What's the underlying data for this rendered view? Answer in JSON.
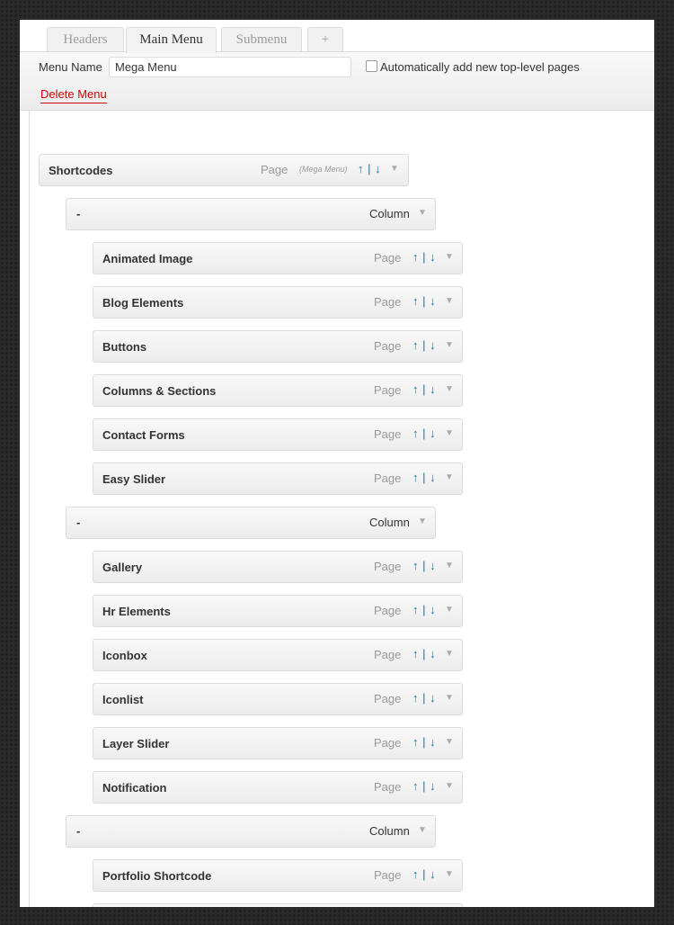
{
  "tabs": [
    {
      "label": "Headers",
      "active": false
    },
    {
      "label": "Main Menu",
      "active": true
    },
    {
      "label": "Submenu",
      "active": false
    },
    {
      "label": "+",
      "active": false
    }
  ],
  "menu_bar": {
    "menu_name_label": "Menu Name",
    "menu_name_value": "Mega Menu",
    "auto_add_label": "Automatically add new top-level pages",
    "auto_add_checked": false,
    "delete_label": "Delete Menu"
  },
  "top_item": {
    "title": "Shortcodes",
    "type": "Page",
    "note": "(Mega Menu)",
    "arrow_up": "↑",
    "arrow_sep": "|",
    "arrow_down": "↓",
    "caret": "▼"
  },
  "columns": [
    {
      "title": "-",
      "type": "Column",
      "caret": "▼",
      "items": [
        {
          "title": "Animated Image",
          "type": "Page"
        },
        {
          "title": "Blog Elements",
          "type": "Page"
        },
        {
          "title": "Buttons",
          "type": "Page"
        },
        {
          "title": "Columns & Sections",
          "type": "Page"
        },
        {
          "title": "Contact Forms",
          "type": "Page"
        },
        {
          "title": "Easy Slider",
          "type": "Page"
        }
      ]
    },
    {
      "title": "-",
      "type": "Column",
      "caret": "▼",
      "items": [
        {
          "title": "Gallery",
          "type": "Page"
        },
        {
          "title": "Hr Elements",
          "type": "Page"
        },
        {
          "title": "Iconbox",
          "type": "Page"
        },
        {
          "title": "Iconlist",
          "type": "Page"
        },
        {
          "title": "Layer Slider",
          "type": "Page"
        },
        {
          "title": "Notification",
          "type": "Page"
        }
      ]
    },
    {
      "title": "-",
      "type": "Column",
      "caret": "▼",
      "items": [
        {
          "title": "Portfolio Shortcode",
          "type": "Page"
        }
      ]
    }
  ],
  "colors": {
    "arrow_blue": "#21759b",
    "delete_red": "#d00000"
  }
}
